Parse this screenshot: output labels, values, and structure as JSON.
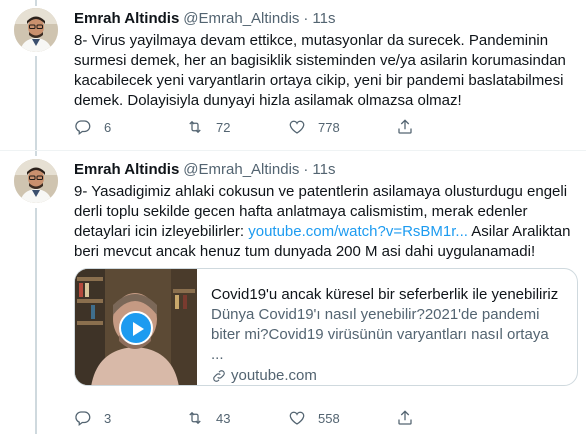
{
  "tweets": [
    {
      "author_name": "Emrah Altindis",
      "handle": "@Emrah_Altindis",
      "separator": "·",
      "time": "11s",
      "lines": [
        "8- Virus yayilmaya devam ettikce, mutasyonlar da surecek. Pandeminin",
        "surmesi demek, her an bagisiklik sisteminden ve/ya asilarin korumasindan",
        "kacabilecek yeni varyantlarin ortaya cikip, yeni bir pandemi baslatabilmesi",
        "demek. Dolayisiyla dunyayi hizla asilamak olmazsa olmaz!"
      ],
      "reply_count": "6",
      "retweet_count": "72",
      "like_count": "778"
    },
    {
      "author_name": "Emrah Altindis",
      "handle": "@Emrah_Altindis",
      "separator": "·",
      "time": "11s",
      "line1": "9- Yasadigimiz ahlaki cokusun ve patentlerin asilamaya olusturdugu engeli",
      "line2": "derli toplu sekilde gecen hafta anlatmaya calismistim, merak edenler",
      "line3_before": "detaylari icin izleyebilirler: ",
      "link": "youtube.com/watch?v=RsBM1r...",
      "line3_after": " Asilar Araliktan",
      "line4": "beri mevcut ancak henuz tum dunyada 200 M asi dahi uygulanamadi!",
      "card": {
        "title": "Covid19'u ancak küresel bir seferberlik ile yenebiliriz",
        "desc_line1": "Dünya Covid19'ı nasıl yenebilir?2021'de pandemi",
        "desc_line2": "biter mi?Covid19 virüsünün varyantları nasıl ortaya ...",
        "domain": "youtube.com"
      },
      "reply_count": "3",
      "retweet_count": "43",
      "like_count": "558"
    }
  ],
  "icons": {
    "reply": "reply-icon",
    "retweet": "retweet-icon",
    "like": "like-icon",
    "share": "share-icon",
    "link": "link-icon",
    "play": "play-icon"
  },
  "colors": {
    "link": "#1d9bf0",
    "secondary_text": "#536471",
    "thread_line": "#cfd9de"
  }
}
